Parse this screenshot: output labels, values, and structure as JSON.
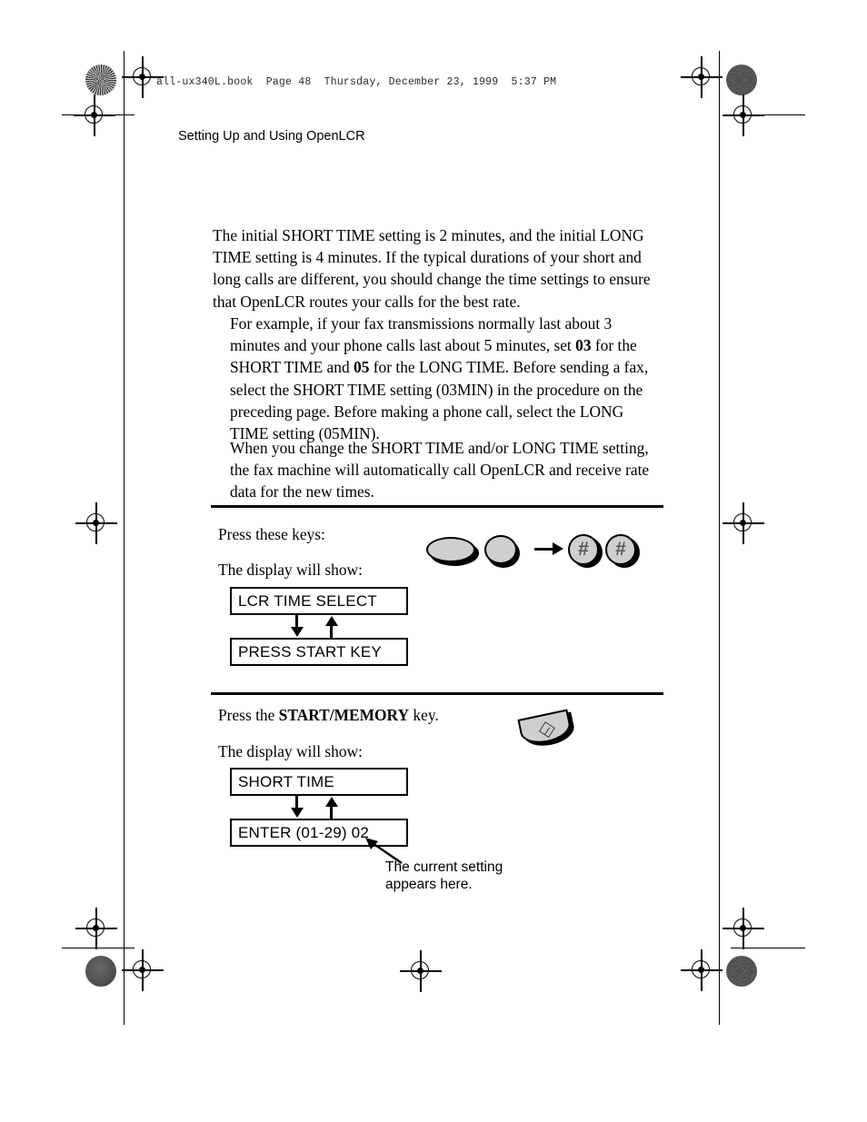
{
  "document": {
    "slug_line": "all-ux340L.book  Page 48  Thursday, December 23, 1999  5:37 PM",
    "running_head": "Setting Up and Using OpenLCR"
  },
  "body": {
    "paragraph_1": "The initial SHORT TIME setting is 2 minutes, and the initial LONG TIME setting is 4 minutes. If the typical durations of your short and long calls are different, you should change the time settings to ensure that OpenLCR routes your calls for the best rate.",
    "paragraph_2_part_1": "For example, if your fax transmissions normally last about 3 minutes and your phone calls last about 5 minutes, set ",
    "paragraph_2_bold_1": "03",
    "paragraph_2_part_2": " for the SHORT TIME and ",
    "paragraph_2_bold_2": "05",
    "paragraph_2_part_3": " for the LONG TIME. Before sending a fax, select the SHORT TIME setting (03MIN) in the procedure on the preceding page. Before making a phone call, select the LONG TIME setting (05MIN).",
    "paragraph_3": "When you change the SHORT TIME and/or LONG TIME setting, the fax machine will automatically call OpenLCR and receive rate data for the new times."
  },
  "step_1": {
    "instruction": "Press these keys:",
    "display_prompt": "The display will show:",
    "keys": [
      {
        "name": "function-key",
        "glyph": ""
      },
      {
        "name": "oval-key",
        "glyph": ""
      },
      {
        "name": "hash-key-1",
        "glyph": "#"
      },
      {
        "name": "hash-key-2",
        "glyph": "#"
      }
    ],
    "display_line_1": "LCR TIME SELECT",
    "display_line_2": "PRESS START KEY"
  },
  "step_2": {
    "instruction_prefix": "Press the ",
    "instruction_bold": "START/MEMORY",
    "instruction_suffix": " key.",
    "display_prompt": "The display will show:",
    "display_line_1": "SHORT TIME",
    "display_line_2": "ENTER (01-29) 02",
    "callout_line_1": "The current setting",
    "callout_line_2": "appears here."
  },
  "colors": {
    "key_face": "#cfcfcf",
    "ink": "#000000",
    "hash_glyph": "#555555"
  }
}
